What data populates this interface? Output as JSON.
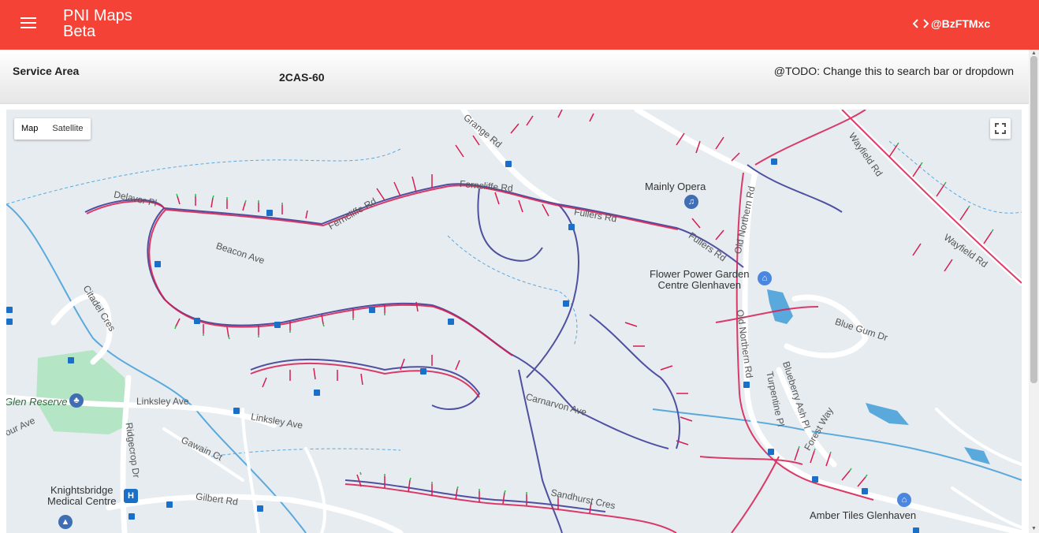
{
  "header": {
    "title_line1": "PNI Maps",
    "title_line2": "Beta",
    "user": "@BzFTMxc",
    "menu_icon": "menu-icon",
    "code_icon": "code-icon"
  },
  "service_area": {
    "label": "Service Area",
    "value": "2CAS-60",
    "note": "@TODO: Change this to search bar or dropdown"
  },
  "map": {
    "type_controls": [
      "Map",
      "Satellite"
    ],
    "fullscreen_icon": "fullscreen-icon",
    "streets": {
      "delavor_pl": "Delavor Pl",
      "ferncliffe_rd_1": "Ferncliffe Rd",
      "ferncliffe_rd_2": "Ferncliffe Rd",
      "beacon_ave": "Beacon Ave",
      "linksley_ave_1": "Linksley Ave",
      "linksley_ave_2": "Linksley Ave",
      "gawain_ct": "Gawain Ct",
      "gilbert_rd": "Gilbert Rd",
      "ridgecrop_dr": "Ridgecrop Dr",
      "citadel_cres": "Citadel Cres",
      "our_ave": "our Ave",
      "old_northern_rd_1": "Old Northern Rd",
      "old_northern_rd_2": "Old Northern Rd",
      "fullers_rd_1": "Fullers Rd",
      "fullers_rd_2": "Fullers Rd",
      "wayfield_rd_1": "Wayfield Rd",
      "wayfield_rd_2": "Wayfield Rd",
      "blue_gum_dr": "Blue Gum Dr",
      "blueberry_ash_pl": "Blueberry Ash Pl",
      "turpentine_pl": "Turpentine Pl",
      "forest_way": "Forest Way",
      "sandhurst_cres": "Sandhurst Cres",
      "carnarvon_ave": "Carnarvon Ave",
      "grange_rd": "Grange Rd"
    },
    "pois": {
      "mainly_opera": "Mainly Opera",
      "flower_power_1": "Flower Power Garden",
      "flower_power_2": "Centre Glenhaven",
      "glen_reserve": "Glen Reserve",
      "knightsbridge_1": "Knightsbridge",
      "knightsbridge_2": "Medical Centre",
      "amber_tiles": "Amber Tiles Glenhaven"
    },
    "colors": {
      "map_bg": "#e6ecf0",
      "road": "#ffffff",
      "water": "#5aa9dc",
      "park": "#b4e5c4",
      "network_red": "#d81b50",
      "network_blue": "#5050a0",
      "tick_green": "#2db84a"
    }
  }
}
